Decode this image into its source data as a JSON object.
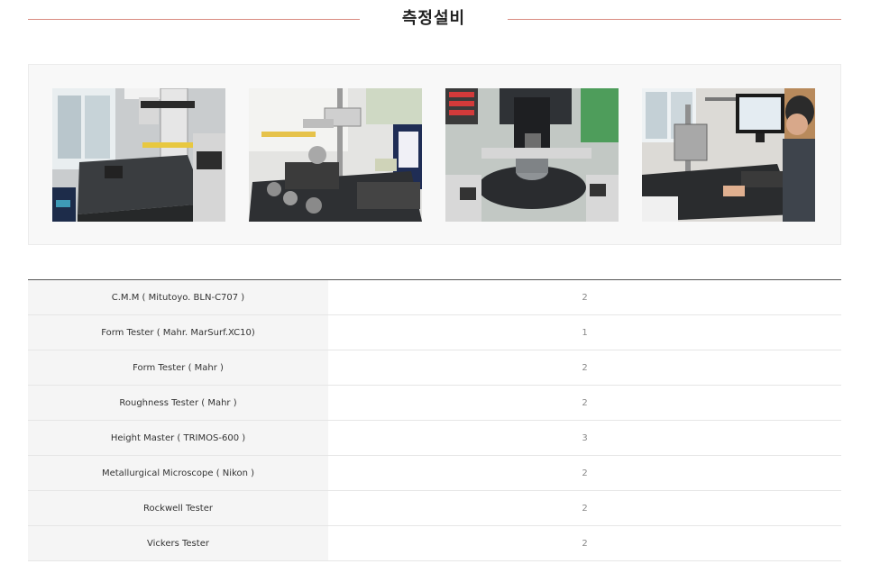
{
  "section": {
    "title": "측정설비"
  },
  "gallery": {
    "photos": [
      {
        "icon": "cmm-machine-photo"
      },
      {
        "icon": "form-tester-photo"
      },
      {
        "icon": "roughness-tester-photo"
      },
      {
        "icon": "height-master-photo"
      }
    ]
  },
  "equipment": [
    {
      "name": "C.M.M ( Mitutoyo. BLN-C707 )",
      "qty": "2"
    },
    {
      "name": "Form Tester ( Mahr. MarSurf.XC10)",
      "qty": "1"
    },
    {
      "name": "Form Tester ( Mahr )",
      "qty": "2"
    },
    {
      "name": "Roughness Tester ( Mahr )",
      "qty": "2"
    },
    {
      "name": "Height Master ( TRIMOS-600 )",
      "qty": "3"
    },
    {
      "name": "Metallurgical Microscope ( Nikon )",
      "qty": "2"
    },
    {
      "name": "Rockwell Tester",
      "qty": "2"
    },
    {
      "name": "Vickers Tester",
      "qty": "2"
    }
  ],
  "colors": {
    "title_line": "#d98a80",
    "table_border": "#555555",
    "name_cell_bg": "#f5f5f5"
  }
}
